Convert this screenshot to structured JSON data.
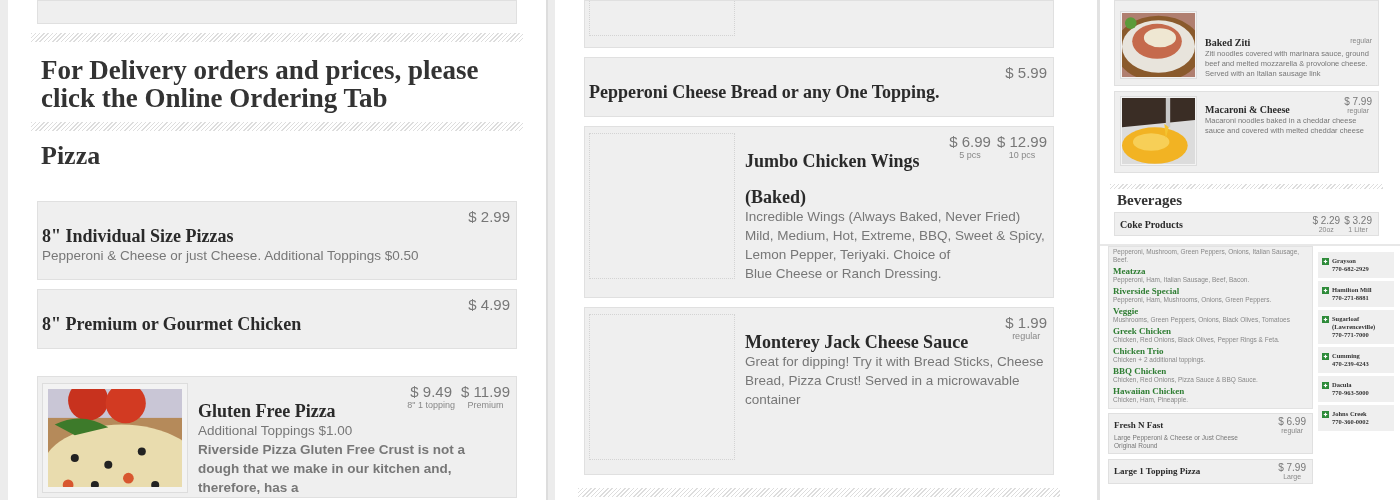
{
  "panels": [
    {
      "blocks": [
        {
          "kind": "card",
          "clipped": true
        },
        {
          "kind": "divider"
        },
        {
          "kind": "notice",
          "text": "For Delivery orders and prices, please click the Online Ordering Tab"
        },
        {
          "kind": "divider"
        },
        {
          "kind": "section",
          "text": "Pizza"
        },
        {
          "kind": "card",
          "name": "8\" Individual Size Pizzas",
          "description": "Pepperoni & Cheese or just Cheese. Additional Toppings $0.50",
          "prices": [
            {
              "amount": "$ 2.99"
            }
          ]
        },
        {
          "kind": "card",
          "name": "8\" Premium or Gourmet Chicken",
          "prices": [
            {
              "amount": "$ 4.99"
            }
          ]
        },
        {
          "kind": "card",
          "image": {
            "kind": "picture"
          },
          "name": "Gluten Free Pizza",
          "description": "Additional Toppings $1.00",
          "note": "Riverside Pizza Gluten Free Crust is not a dough that we make in our kitchen and, therefore, has a",
          "prices": [
            {
              "amount": "$ 9.49",
              "label": "8\" 1 topping"
            },
            {
              "amount": "$ 11.99",
              "label": "Premium"
            }
          ]
        }
      ]
    },
    {
      "blocks": [
        {
          "kind": "card",
          "clipped": true,
          "image": {
            "kind": "placeholder"
          }
        },
        {
          "kind": "card",
          "name": "Pepperoni Cheese Bread or any One Topping.",
          "prices": [
            {
              "amount": "$ 5.99"
            }
          ]
        },
        {
          "kind": "card",
          "image": {
            "kind": "placeholder"
          },
          "name": "Jumbo Chicken Wings",
          "subtitle": "(Baked)",
          "description": "Incredible Wings (Always Baked, Never Fried) Mild, Medium, Hot, Extreme, BBQ, Sweet & Spicy, Lemon Pepper, Teriyaki. Choice of\nBlue Cheese or Ranch Dressing.",
          "prices": [
            {
              "amount": "$ 6.99",
              "label": "5 pcs"
            },
            {
              "amount": "$ 12.99",
              "label": "10 pcs"
            }
          ]
        },
        {
          "kind": "card",
          "image": {
            "kind": "placeholder"
          },
          "name": "Monterey Jack Cheese Sauce",
          "description": "Great for dipping! Try it with Bread Sticks, Cheese Bread, Pizza Crust! Served in a microwavable container",
          "prices": [
            {
              "amount": "$ 1.99",
              "label": "regular"
            }
          ]
        },
        {
          "kind": "divider"
        }
      ]
    },
    {
      "blocks": [
        {
          "kind": "card",
          "clipped": true,
          "image": {
            "kind": "picture"
          },
          "name": "Baked Ziti",
          "description": "Ziti noodles covered with marinara sauce, ground beef and melted mozzarella & provolone cheese. Served with an Italian sausage link",
          "prices": [
            {
              "label": "regular"
            }
          ]
        },
        {
          "kind": "card",
          "image": {
            "kind": "picture"
          },
          "name": "Macaroni & Cheese",
          "description": "Macaroni noodles baked in a cheddar cheese sauce and covered with melted cheddar cheese",
          "prices": [
            {
              "amount": "$ 7.99",
              "label": "regular"
            }
          ]
        },
        {
          "kind": "divider"
        },
        {
          "kind": "section",
          "text": "Beverages"
        },
        {
          "kind": "card",
          "name": "Coke Products",
          "prices": [
            {
              "amount": "$ 2.29",
              "label": "20oz"
            },
            {
              "amount": "$ 3.29",
              "label": "1 Liter"
            }
          ]
        }
      ]
    },
    {
      "blocks": [
        {
          "kind": "list",
          "items": [
            {
              "description": "Pepperoni, Mushroom, Green Peppers, Onions, Italian Sausage, Beef."
            },
            {
              "name": "Meatzza",
              "description": "Pepperoni, Ham, Italian Sausage, Beef, Bacon."
            },
            {
              "name": "Riverside Special",
              "description": "Pepperoni, Ham, Mushrooms, Onions, Green Peppers."
            },
            {
              "name": "Veggie",
              "description": "Mushrooms, Green Peppers, Onions, Black Olives, Tomatoes"
            },
            {
              "name": "Greek Chicken",
              "description": "Chicken, Red Onions, Black Olives, Pepper Rings & Feta."
            },
            {
              "name": "Chicken Trio",
              "description": "Chicken + 2 additional toppings."
            },
            {
              "name": "BBQ Chicken",
              "description": "Chicken, Red Onions, Pizza Sauce & BBQ Sauce."
            },
            {
              "name": "Hawaiian Chicken",
              "description": "Chicken, Ham, Pineapple."
            }
          ]
        },
        {
          "kind": "card",
          "name": "Fresh N Fast",
          "description": "Large Pepperoni & Cheese or Just Cheese\nOriginal Round",
          "prices": [
            {
              "amount": "$ 6.99",
              "label": "regular"
            }
          ]
        },
        {
          "kind": "card",
          "name": "Large 1 Topping Pizza",
          "prices": [
            {
              "amount": "$ 7.99",
              "label": "Large"
            }
          ]
        }
      ],
      "locations": [
        {
          "name": "Grayson",
          "phone": "770-682-2929"
        },
        {
          "name": "Hamilton Mill",
          "phone": "770-271-8881"
        },
        {
          "name": "Sugarloaf (Lawrenceville)",
          "phone": "770-771-7000"
        },
        {
          "name": "Cumming",
          "phone": "470-239-4243"
        },
        {
          "name": "Dacula",
          "phone": "770-963-5000"
        },
        {
          "name": "Johns Creek",
          "phone": "770-360-0002"
        }
      ]
    }
  ]
}
